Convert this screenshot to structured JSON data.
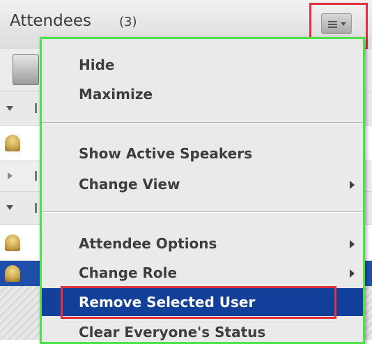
{
  "pod": {
    "title": "Attendees",
    "count": "(3)"
  },
  "menu": {
    "items": [
      {
        "label": "Hide",
        "submenu": false
      },
      {
        "label": "Maximize",
        "submenu": false
      },
      {
        "label": "Show Active Speakers",
        "submenu": false
      },
      {
        "label": "Change View",
        "submenu": true
      },
      {
        "label": "Attendee Options",
        "submenu": true
      },
      {
        "label": "Change Role",
        "submenu": true
      },
      {
        "label": "Remove Selected User",
        "submenu": false,
        "highlighted": true
      },
      {
        "label": "Clear Everyone's Status",
        "submenu": false
      }
    ]
  },
  "colors": {
    "menu_border": "#4ee24a",
    "callout_red": "#e0313c",
    "highlight_blue": "#123f9a",
    "selected_row_blue": "#1f4fa8"
  },
  "icons": [
    "pod-menu-icon",
    "chevron-down-icon",
    "attendee-icon",
    "submenu-arrow-icon"
  ]
}
